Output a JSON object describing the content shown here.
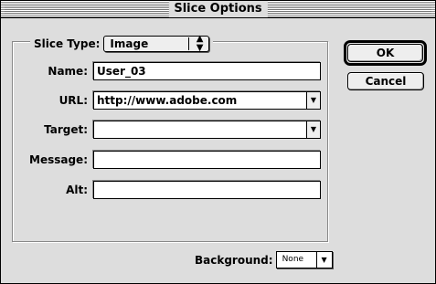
{
  "window": {
    "title": "Slice Options"
  },
  "slice_type": {
    "label": "Slice Type:",
    "value": "Image"
  },
  "fields": {
    "name": {
      "label": "Name:",
      "value": "User_03"
    },
    "url": {
      "label": "URL:",
      "value": "http://www.adobe.com"
    },
    "target": {
      "label": "Target:",
      "value": ""
    },
    "message": {
      "label": "Message:",
      "value": ""
    },
    "alt": {
      "label": "Alt:",
      "value": ""
    }
  },
  "buttons": {
    "ok": "OK",
    "cancel": "Cancel"
  },
  "background": {
    "label": "Background:",
    "value": "None"
  },
  "icons": {
    "popup_arrows": "up-down-arrows-icon",
    "dropdown": "down-triangle-icon"
  }
}
